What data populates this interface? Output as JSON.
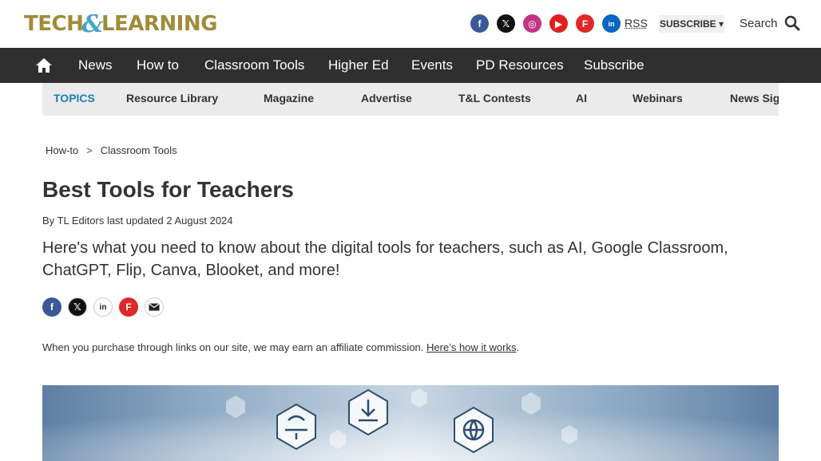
{
  "header": {
    "logo_left": "TECH",
    "logo_amp": "&",
    "logo_right": "LEARNING",
    "social": [
      {
        "name": "facebook-icon",
        "glyph": "f"
      },
      {
        "name": "x-twitter-icon",
        "glyph": "𝕏"
      },
      {
        "name": "instagram-icon",
        "glyph": "◎"
      },
      {
        "name": "youtube-icon",
        "glyph": "▶"
      },
      {
        "name": "flipboard-icon",
        "glyph": "F"
      },
      {
        "name": "linkedin-icon",
        "glyph": "in"
      }
    ],
    "rss_label": "RSS",
    "subscribe_label": "SUBSCRIBE ▾",
    "search_label": "Search"
  },
  "nav": {
    "items": [
      "News",
      "How to",
      "Classroom Tools",
      "Higher Ed",
      "Events",
      "PD Resources",
      "Subscribe"
    ]
  },
  "topics": {
    "lead": "TOPICS",
    "items": [
      "Resource Library",
      "Magazine",
      "Advertise",
      "T&L Contests",
      "AI",
      "Webinars",
      "News Sign"
    ]
  },
  "article": {
    "breadcrumb": [
      "How-to",
      ">",
      "Classroom Tools"
    ],
    "title": "Best Tools for Teachers",
    "byline_prefix": "By ",
    "author": "TL Editors",
    "updated": " last updated 2 August 2024",
    "standfirst": "Here's what you need to know about the digital tools for teachers, such as AI, Google Classroom, ChatGPT, Flip, Canva, Blooket, and more!",
    "affiliate_text": "When you purchase through links on our site, we may earn an affiliate commission. ",
    "affiliate_link": "Here’s how it works",
    "affiliate_end": "."
  },
  "colors": {
    "nav_bg": "#2f2f2f",
    "topics_bg": "#ebebeb",
    "topic_lead": "#1a7fb8",
    "logo_gold": "#a08b3a",
    "logo_blue": "#4aa3c8"
  }
}
